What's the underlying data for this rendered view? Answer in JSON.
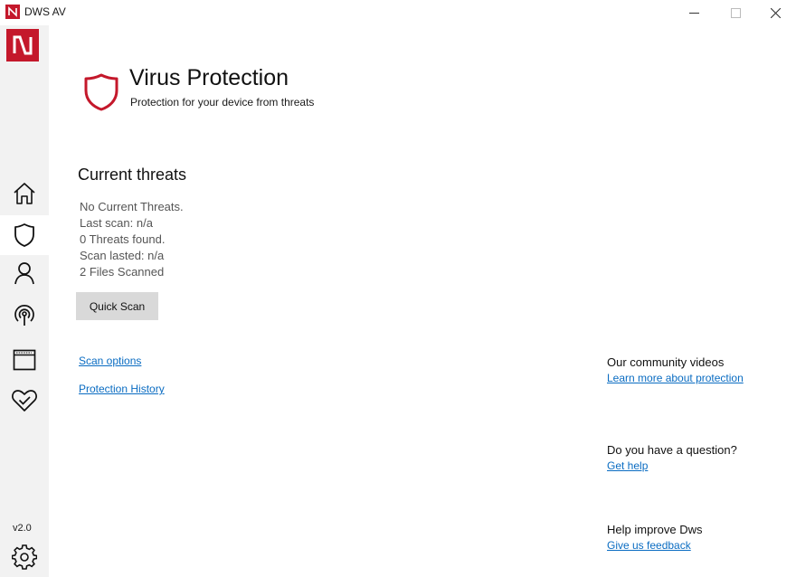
{
  "window": {
    "title": "DWS AV",
    "brand_color": "#c4182b"
  },
  "sidebar": {
    "items": [
      {
        "name": "home",
        "icon": "home-icon",
        "active": false
      },
      {
        "name": "virus-protection",
        "icon": "shield-icon",
        "active": true
      },
      {
        "name": "account",
        "icon": "person-icon",
        "active": false
      },
      {
        "name": "network",
        "icon": "broadcast-icon",
        "active": false
      },
      {
        "name": "app-browser",
        "icon": "browser-window-icon",
        "active": false
      },
      {
        "name": "device-health",
        "icon": "heart-check-icon",
        "active": false
      }
    ],
    "version": "v2.0",
    "settings_icon": "gear-icon"
  },
  "header": {
    "title": "Virus Protection",
    "subtitle": "Protection for your device from threats",
    "icon": "shield-icon"
  },
  "threats": {
    "title": "Current threats",
    "status": [
      "No Current Threats.",
      "Last scan: n/a",
      "0 Threats found.",
      "Scan lasted: n/a",
      "2 Files Scanned"
    ],
    "quick_scan_label": "Quick Scan",
    "scan_options_link": "Scan options",
    "history_link": "Protection History"
  },
  "right_panel": {
    "community": {
      "heading": "Our community videos",
      "link": "Learn more about protection"
    },
    "question": {
      "heading": "Do you have a question?",
      "link": "Get help"
    },
    "improve": {
      "heading": "Help improve Dws",
      "link": "Give us feedback"
    }
  }
}
